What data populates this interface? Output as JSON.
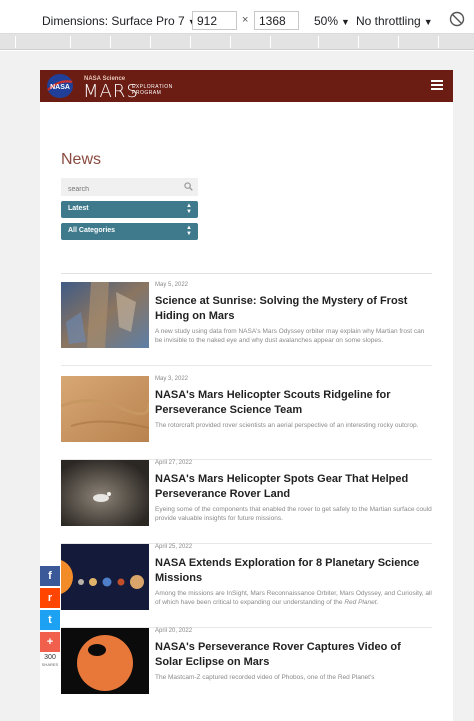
{
  "devtools": {
    "device_label": "Dimensions: Surface Pro 7",
    "width_value": "912",
    "times": "×",
    "height_value": "1368",
    "zoom_label": "50%",
    "throttle_label": "No throttling"
  },
  "site": {
    "agency": "NASA Science",
    "title": "MARS",
    "subtitle_line1": "EXPLORATION",
    "subtitle_line2": "PROGRAM",
    "header_color": "#6b1d14"
  },
  "news": {
    "heading": "News",
    "search_placeholder": "search",
    "sort_value": "Latest",
    "category_value": "All Categories"
  },
  "articles": [
    {
      "date": "May 5, 2022",
      "title": "Science at Sunrise: Solving the Mystery of Frost Hiding on Mars",
      "teaser": "A new study using data from NASA's Mars Odyssey orbiter may explain why Martian frost can be invisible to the naked eye and why dust avalanches appear on some slopes."
    },
    {
      "date": "May 3, 2022",
      "title": "NASA's Mars Helicopter Scouts Ridgeline for Perseverance Science Team",
      "teaser": "The rotorcraft provided rover scientists an aerial perspective of an interesting rocky outcrop."
    },
    {
      "date": "April 27, 2022",
      "title": "NASA's Mars Helicopter Spots Gear That Helped Perseverance Rover Land",
      "teaser": "Eyeing some of the components that enabled the rover to get safely to the Martian surface could provide valuable insights for future missions."
    },
    {
      "date": "April 25, 2022",
      "title": "NASA Extends Exploration for 8 Planetary Science Missions",
      "teaser": "Among the missions are InSight, Mars Reconnaissance Orbiter, Mars Odyssey, and Curiosity, all of which have been critical to expanding our understanding of the",
      "teaser_em": "Red Planet."
    },
    {
      "date": "April 20, 2022",
      "title": "NASA's Perseverance Rover Captures Video of Solar Eclipse on Mars",
      "teaser": "The Mastcam-Z captured recorded video of Phobos, one of the Red Planet's"
    }
  ],
  "share": {
    "count": "300",
    "count_label": "SHARES",
    "facebook_icon": "f",
    "reddit_icon": "r",
    "twitter_icon": "t",
    "more_icon": "+",
    "facebook_color": "#3b5998",
    "reddit_color": "#ff4500",
    "twitter_color": "#1da1f2",
    "more_color": "#f0604d"
  }
}
